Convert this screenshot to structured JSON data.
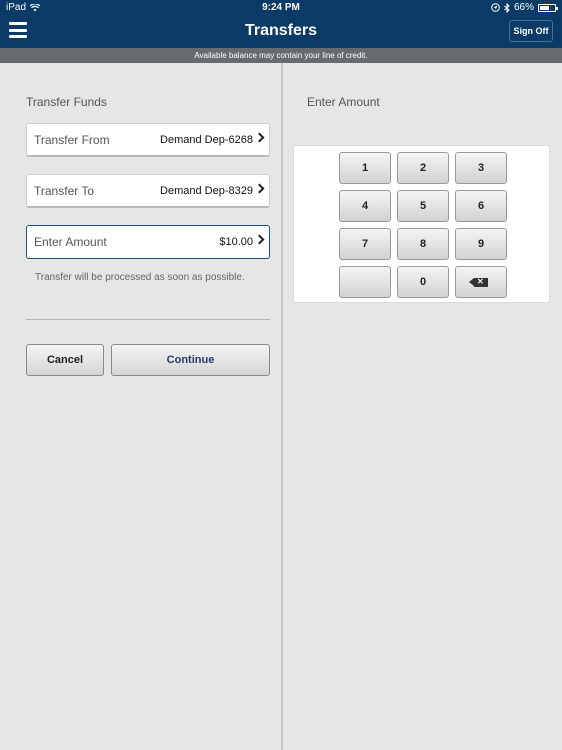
{
  "status_bar": {
    "device": "iPad",
    "time": "9:24 PM",
    "battery": "66%",
    "battery_level": 0.66,
    "icons": [
      "wifi-icon",
      "location-icon",
      "bluetooth-icon",
      "battery-icon"
    ]
  },
  "nav": {
    "title": "Transfers",
    "sign_off": "Sign Off",
    "menu_icon": "hamburger-menu-icon"
  },
  "notice": "Available balance may contain your line of credit.",
  "transfer": {
    "section_title": "Transfer Funds",
    "from_label": "Transfer From",
    "from_value": "Demand Dep-6268",
    "to_label": "Transfer To",
    "to_value": "Demand Dep-8329",
    "amount_label": "Enter Amount",
    "amount_value": "$10.00",
    "note": "Transfer will be processed as soon as possible.",
    "cancel_label": "Cancel",
    "continue_label": "Continue"
  },
  "keypad": {
    "title": "Enter Amount",
    "keys": [
      "1",
      "2",
      "3",
      "4",
      "5",
      "6",
      "7",
      "8",
      "9",
      "",
      "0",
      "⌫"
    ]
  },
  "colors": {
    "nav_bg": "#0a3a66",
    "notice_bg": "#666b70",
    "panel_bg": "#e6e6e6",
    "active_border": "#1f4e7a"
  }
}
